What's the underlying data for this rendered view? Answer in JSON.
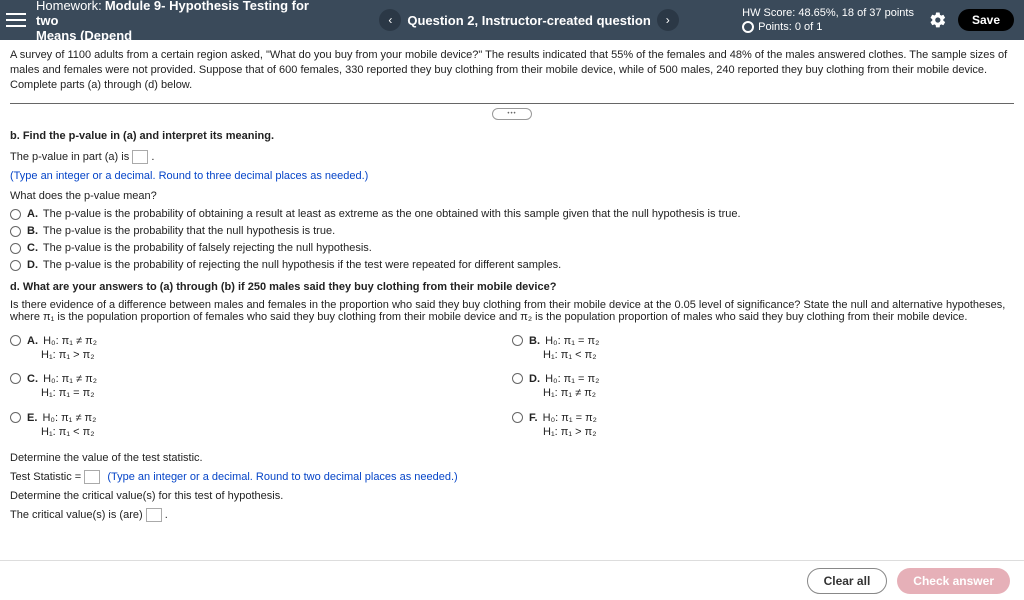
{
  "header": {
    "prefix": "Homework:",
    "assignment_line1": "Module 9- Hypothesis Testing for two",
    "assignment_line2": "Means (Depend",
    "question_label": "Question 2, Instructor-created question",
    "score_line": "HW Score: 48.65%, 18 of 37 points",
    "points_line": "Points: 0 of 1",
    "save_label": "Save"
  },
  "intro": "A survey of 1100 adults from a certain region asked, \"What do you buy from your mobile device?\" The results indicated that 55% of the females and 48% of the males answered clothes. The sample sizes of males and females were not provided. Suppose that of 600 females, 330 reported they buy clothing from their mobile device, while of 500 males, 240 reported they buy clothing from their mobile device. Complete parts (a) through (d) below.",
  "part_b": {
    "title": "b. Find the p-value in (a) and interpret its meaning.",
    "pvalue_pre": "The p-value in part (a) is ",
    "pvalue_post": ".",
    "hint": "(Type an integer or a decimal. Round to three decimal places as needed.)",
    "meaning_q": "What does the p-value mean?",
    "choices": {
      "A": "The p-value is the probability of obtaining a result at least as extreme as the one obtained with this sample given that the null hypothesis is true.",
      "B": "The p-value is the probability that the null hypothesis is true.",
      "C": "The p-value is the probability of falsely rejecting the null hypothesis.",
      "D": "The p-value is the probability of rejecting the null hypothesis if the test were repeated for different samples."
    }
  },
  "part_d": {
    "title": "d. What are your answers to (a) through (b) if 250 males said they buy clothing from their mobile device?",
    "question": "Is there evidence of a difference between males and females in the proportion who said they buy clothing from their mobile device at the 0.05 level of significance? State the null and alternative hypotheses, where π₁ is the population proportion of females who said they buy clothing from their mobile device and π₂ is the population proportion of males who said they buy clothing from their mobile device.",
    "hyp": {
      "A": {
        "h0": "H₀: π₁ ≠ π₂",
        "h1": "H₁: π₁ > π₂"
      },
      "B": {
        "h0": "H₀: π₁ = π₂",
        "h1": "H₁: π₁ < π₂"
      },
      "C": {
        "h0": "H₀: π₁ ≠ π₂",
        "h1": "H₁: π₁ = π₂"
      },
      "D": {
        "h0": "H₀: π₁ = π₂",
        "h1": "H₁: π₁ ≠ π₂"
      },
      "E": {
        "h0": "H₀: π₁ ≠ π₂",
        "h1": "H₁: π₁ < π₂"
      },
      "F": {
        "h0": "H₀: π₁ = π₂",
        "h1": "H₁: π₁ > π₂"
      }
    },
    "teststat_label": "Determine the value of the test statistic.",
    "teststat_pre": "Test Statistic = ",
    "teststat_hint": "(Type an integer or a decimal. Round to two decimal places as needed.)",
    "crit_label": "Determine the critical value(s) for this test of hypothesis.",
    "crit_pre": "The critical value(s) is (are) ",
    "crit_post": "."
  },
  "footer": {
    "clear": "Clear all",
    "check": "Check answer"
  }
}
